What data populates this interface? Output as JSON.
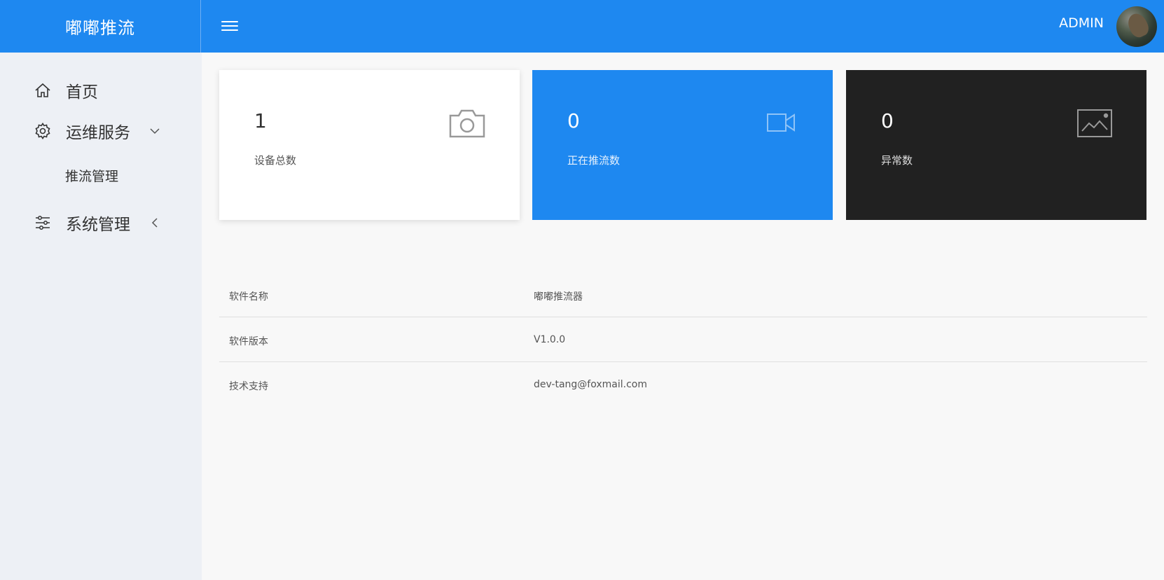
{
  "header": {
    "brand": "嘟嘟推流",
    "user_name": "ADMIN"
  },
  "sidebar": {
    "items": [
      {
        "label": "首页",
        "icon": "home-icon"
      },
      {
        "label": "运维服务",
        "icon": "gear-icon",
        "expanded": true,
        "children": [
          {
            "label": "推流管理"
          }
        ]
      },
      {
        "label": "系统管理",
        "icon": "sliders-icon",
        "expanded": false
      }
    ]
  },
  "cards": [
    {
      "value": "1",
      "label": "设备总数",
      "icon": "camera-icon",
      "bg": "#ffffff"
    },
    {
      "value": "0",
      "label": "正在推流数",
      "icon": "video-camera-icon",
      "bg": "#1e88f0"
    },
    {
      "value": "0",
      "label": "异常数",
      "icon": "image-icon",
      "bg": "#212121"
    }
  ],
  "info": [
    {
      "key": "软件名称",
      "value": "嘟嘟推流器"
    },
    {
      "key": "软件版本",
      "value": "V1.0.0"
    },
    {
      "key": "技术支持",
      "value": "dev-tang@foxmail.com"
    }
  ],
  "colors": {
    "primary": "#1e88f0",
    "dark": "#212121",
    "sidebar_bg": "#edf0f5",
    "content_bg": "#f8f8f8"
  }
}
